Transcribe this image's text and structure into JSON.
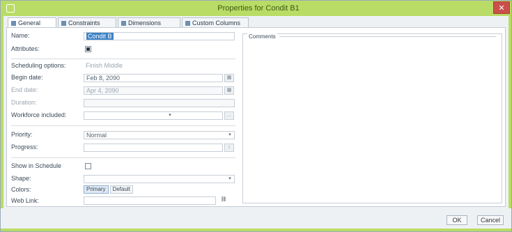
{
  "window": {
    "title": "Properties for Condit B1",
    "close_label": "✕"
  },
  "tabs": [
    {
      "label": "General",
      "icon": "general-icon"
    },
    {
      "label": "Constraints",
      "icon": "constraints-icon"
    },
    {
      "label": "Dimensions",
      "icon": "dimensions-icon"
    },
    {
      "label": "Custom Columns",
      "icon": "custom-columns-icon"
    }
  ],
  "general": {
    "name_label": "Name:",
    "name_value": "Condit B",
    "attributes_label": "Attributes:",
    "scheduling_label": "Scheduling options:",
    "scheduling_value": "Finish Middle",
    "begin_date_label": "Begin date:",
    "begin_date_value": "Feb 8, 2090",
    "end_date_label": "End date:",
    "end_date_value": "Apr 4, 2090",
    "duration_label": "Duration:",
    "duration_value": "",
    "workforce_label": "Workforce included:",
    "workforce_value": "",
    "priority_label": "Priority:",
    "priority_value": "Normal",
    "progress_label": "Progress:",
    "progress_value": "",
    "show_schedule_label": "Show in Schedule",
    "shape_label": "Shape:",
    "shape_value": "",
    "colors_label": "Colors:",
    "colors_options": [
      "Primary",
      "Default"
    ],
    "web_link_label": "Web Link:",
    "web_link_value": "",
    "comments_label": "Comments"
  },
  "footer": {
    "ok_label": "OK",
    "cancel_label": "Cancel"
  },
  "colors": {
    "accent": "#b9dc66",
    "close": "#c9504b",
    "selection": "#3d82c4"
  }
}
